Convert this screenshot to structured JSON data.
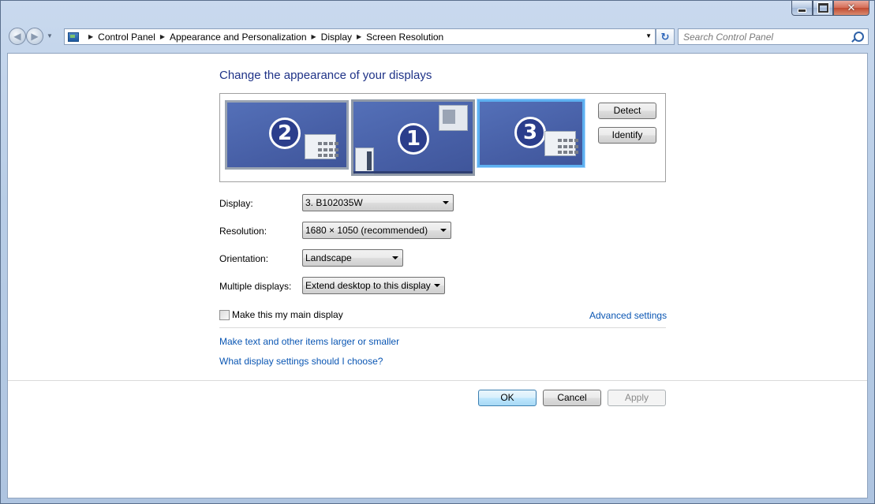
{
  "window": {
    "caption_buttons": {
      "minimize_icon": "minimize-icon",
      "maximize_icon": "maximize-icon",
      "close_icon": "close-icon",
      "close_glyph": "✕"
    }
  },
  "navigation": {
    "back_glyph": "◀",
    "forward_glyph": "▶",
    "breadcrumbs": [
      "Control Panel",
      "Appearance and Personalization",
      "Display",
      "Screen Resolution"
    ],
    "refresh_glyph": "↻",
    "search_placeholder": "Search Control Panel"
  },
  "main": {
    "title": "Change the appearance of your displays",
    "monitors": [
      {
        "number": "2",
        "selected": false
      },
      {
        "number": "1",
        "selected": false
      },
      {
        "number": "3",
        "selected": true
      }
    ],
    "detect_label": "Detect",
    "identify_label": "Identify",
    "fields": {
      "display": {
        "label": "Display:",
        "value": "3. B102035W"
      },
      "resolution": {
        "label": "Resolution:",
        "value": "1680 × 1050 (recommended)"
      },
      "orientation": {
        "label": "Orientation:",
        "value": "Landscape"
      },
      "multiple_displays": {
        "label": "Multiple displays:",
        "value": "Extend desktop to this display"
      }
    },
    "main_display_checkbox": {
      "label": "Make this my main display",
      "checked": false
    },
    "advanced_settings": "Advanced settings",
    "links": [
      "Make text and other items larger or smaller",
      "What display settings should I choose?"
    ],
    "buttons": {
      "ok": "OK",
      "cancel": "Cancel",
      "apply": "Apply"
    }
  },
  "colors": {
    "title": "#1e3287",
    "link": "#0a56b3",
    "selected_monitor_border": "#5db0f0"
  }
}
